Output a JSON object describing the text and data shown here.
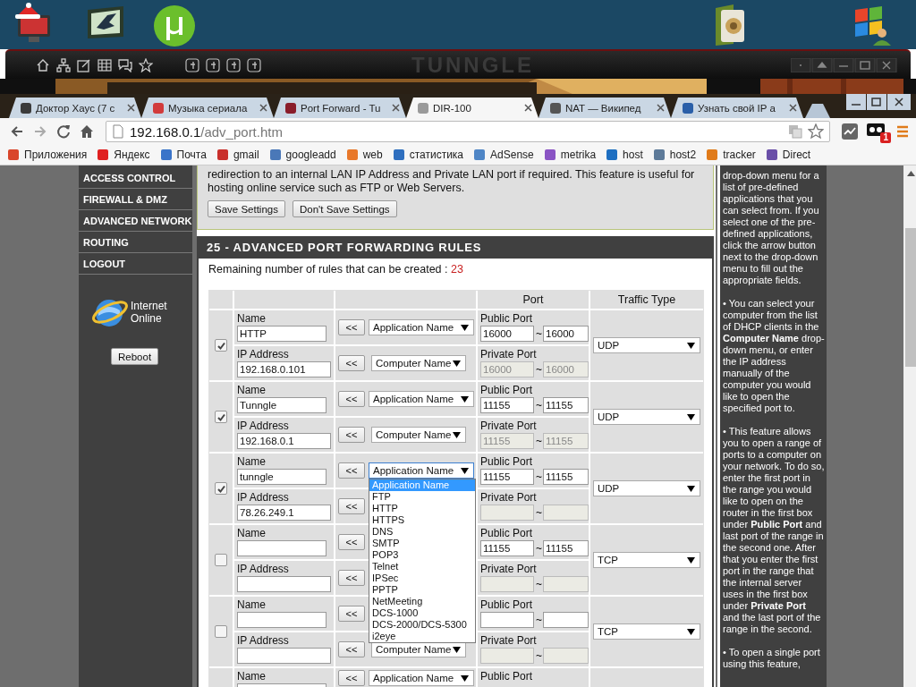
{
  "tunngle": {
    "logo": "TUNNGLE"
  },
  "browser": {
    "tabs": [
      {
        "title": "Доктор Хаус (7 с",
        "selected": false,
        "color": "#3b3b3b"
      },
      {
        "title": "Музыка сериала",
        "selected": false,
        "color": "#d23b3b"
      },
      {
        "title": "Port Forward - Tu",
        "selected": false,
        "color": "#8a1d2a"
      },
      {
        "title": "DIR-100",
        "selected": true,
        "color": "#9a9a9a"
      },
      {
        "title": "NAT — Википед",
        "selected": false,
        "color": "#555555"
      },
      {
        "title": "Узнать свой IP а",
        "selected": false,
        "color": "#2a5fa8"
      }
    ],
    "url": {
      "host": "192.168.0.1",
      "path": "/adv_port.htm"
    },
    "extension_badge": "1",
    "bookmarks": [
      {
        "label": "Приложения",
        "color": "#d9462b"
      },
      {
        "label": "Яндекс",
        "color": "#e02020"
      },
      {
        "label": "Почта",
        "color": "#3a74c9"
      },
      {
        "label": "gmail",
        "color": "#c9302c"
      },
      {
        "label": "googleadd",
        "color": "#4a78b8"
      },
      {
        "label": "web",
        "color": "#e8782a"
      },
      {
        "label": "статистика",
        "color": "#2f6fbf"
      },
      {
        "label": "AdSense",
        "color": "#4f86c6"
      },
      {
        "label": "metrika",
        "color": "#8a54c4"
      },
      {
        "label": "host",
        "color": "#1e6fc1"
      },
      {
        "label": "host2",
        "color": "#5d7a99"
      },
      {
        "label": "tracker",
        "color": "#e07b1a"
      },
      {
        "label": "Direct",
        "color": "#6a4fa8"
      }
    ]
  },
  "sidebar": {
    "items": [
      "ACCESS CONTROL",
      "FIREWALL & DMZ",
      "ADVANCED NETWORK",
      "ROUTING",
      "LOGOUT"
    ],
    "status": "Internet Online",
    "reboot_button": "Reboot"
  },
  "intro": {
    "text": "redirection to an internal LAN IP Address and Private LAN port if required. This feature is useful for hosting online service such as FTP or Web Servers.",
    "buttons": [
      "Save Settings",
      "Don't Save Settings"
    ]
  },
  "rules": {
    "title": "25 - ADVANCED PORT FORWARDING RULES",
    "remaining_label": "Remaining number of rules that can be created :",
    "remaining_count": "23",
    "columns": {
      "port": "Port",
      "traffic_type": "Traffic Type"
    },
    "rows": [
      {
        "checked": true,
        "name_label": "Name",
        "name": "HTTP",
        "name_copy": "<<",
        "app_select": "Application Name",
        "ip_label": "IP Address",
        "ip": "192.168.0.101",
        "ip_copy": "<<",
        "computer_select": "Computer Name",
        "public_label": "Public Port",
        "public_from": "16000",
        "public_sep": "~",
        "public_to": "16000",
        "private_label": "Private Port",
        "private_from": "16000",
        "private_sep": "~",
        "private_to": "16000",
        "traffic": "UDP"
      },
      {
        "checked": true,
        "name_label": "Name",
        "name": "Tunngle",
        "name_copy": "<<",
        "app_select": "Application Name",
        "ip_label": "IP Address",
        "ip": "192.168.0.1",
        "ip_copy": "<<",
        "computer_select": "Computer Name",
        "public_label": "Public Port",
        "public_from": "11155",
        "public_sep": "~",
        "public_to": "11155",
        "private_label": "Private Port",
        "private_from": "11155",
        "private_sep": "~",
        "private_to": "11155",
        "traffic": "UDP"
      },
      {
        "checked": true,
        "name_label": "Name",
        "name": "tunngle",
        "name_copy": "<<",
        "app_select": "Application Name",
        "ip_label": "IP Address",
        "ip": "78.26.249.1",
        "ip_copy": "<<",
        "public_label": "Public Port",
        "public_from": "11155",
        "public_sep": "~",
        "public_to": "11155",
        "private_label": "Private Port",
        "private_sep": "~",
        "traffic": "UDP",
        "dropdown": [
          {
            "label": "Application Name",
            "selected": true
          },
          {
            "label": "FTP",
            "selected": false
          },
          {
            "label": "HTTP",
            "selected": false
          },
          {
            "label": "HTTPS",
            "selected": false
          },
          {
            "label": "DNS",
            "selected": false
          },
          {
            "label": "SMTP",
            "selected": false
          },
          {
            "label": "POP3",
            "selected": false
          },
          {
            "label": "Telnet",
            "selected": false
          },
          {
            "label": "IPSec",
            "selected": false
          },
          {
            "label": "PPTP",
            "selected": false
          },
          {
            "label": "NetMeeting",
            "selected": false
          },
          {
            "label": "DCS-1000",
            "selected": false
          },
          {
            "label": "DCS-2000/DCS-5300",
            "selected": false
          },
          {
            "label": "i2eye",
            "selected": false
          }
        ]
      },
      {
        "checked": false,
        "name_label": "Name",
        "name_copy": "<<",
        "ip_label": "IP Address",
        "ip_copy": "<<",
        "public_label": "Public Port",
        "public_from": "11155",
        "public_sep": "~",
        "public_to": "11155",
        "private_label": "Private Port",
        "private_sep": "~",
        "traffic": "TCP"
      },
      {
        "checked": false,
        "name_label": "Name",
        "name_copy": "<<",
        "ip_label": "IP Address",
        "ip_copy": "<<",
        "computer_select": "Computer Name",
        "public_label": "Public Port",
        "public_sep": "~",
        "private_label": "Private Port",
        "private_sep": "~",
        "traffic": "TCP"
      },
      {
        "name_label": "Name",
        "name_copy": "<<",
        "app_select": "Application Name",
        "public_label": "Public Port"
      }
    ]
  },
  "help": {
    "paragraphs": [
      "drop-down menu for a list of pre-defined applications that you can select from. If you select one of the pre-defined applications, click the arrow button next to the drop-down menu to fill out the appropriate fields.",
      "• You can select your computer from the list of DHCP clients in the **Computer Name** drop-down menu, or enter the IP address manually of the computer you would like to open the specified port to.",
      "• This feature allows you to open a range of ports to a computer on your network. To do so, enter the first port in the range you would like to open on the router in the first box under **Public Port** and last port of the range in the second one. After that you enter the first port in the range that the internal server uses in the first box under **Private Port** and the last port of the range in the second.",
      "• To open a single port using this feature,"
    ]
  }
}
